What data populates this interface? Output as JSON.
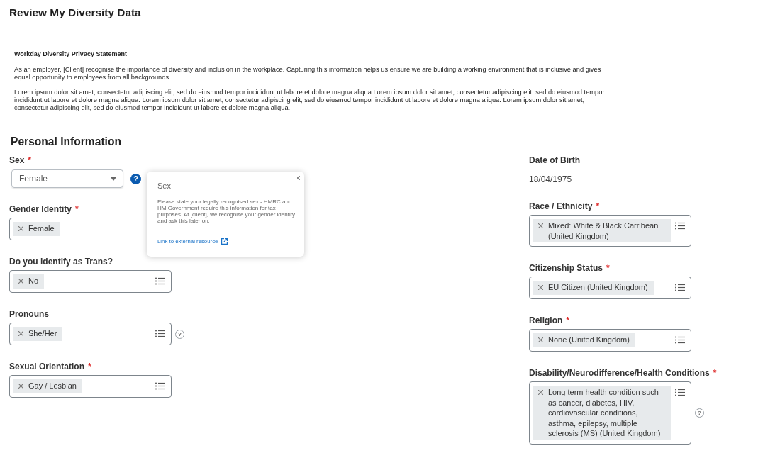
{
  "header": {
    "title": "Review My Diversity Data"
  },
  "privacy_statement": {
    "title": "Workday Diversity Privacy Statement",
    "paragraphs": [
      "As an employer, [Client] recognise the importance of diversity and inclusion in the workplace. Capturing this information helps us ensure we are building a working environment that is inclusive and gives equal opportunity to employees from all backgrounds.",
      "Lorem ipsum dolor sit amet, consectetur adipiscing elit, sed do eiusmod tempor incididunt ut labore et dolore magna aliqua.Lorem ipsum dolor sit amet, consectetur adipiscing elit, sed do eiusmod tempor incididunt ut labore et dolore magna aliqua. Lorem ipsum dolor sit amet, consectetur adipiscing elit, sed do eiusmod tempor incididunt ut labore et dolore magna aliqua. Lorem ipsum dolor sit amet, consectetur adipiscing elit, sed do eiusmod tempor incididunt ut labore et dolore magna aliqua."
    ]
  },
  "personal_information": {
    "title": "Personal Information",
    "left_fields": [
      {
        "kind": "dropdown",
        "label": "Sex",
        "required_mark": "*",
        "value": "Female",
        "help": {
          "text": "?",
          "active": true
        },
        "popover": {
          "title": "Sex",
          "text": "Please state your legally recognised sex - HMRC and HM Government require this information for tax purposes. At [client], we recognise your gender identity and ask this later on.",
          "link": "Link to external resource"
        }
      },
      {
        "kind": "multiselect",
        "label": "Gender Identity",
        "required_mark": "*",
        "tags": [
          "Female"
        ],
        "list_icon": false
      },
      {
        "kind": "multiselect",
        "label": "Do you identify as Trans?",
        "tags": [
          "No"
        ],
        "list_icon": true
      },
      {
        "kind": "multiselect",
        "label": "Pronouns",
        "tags": [
          "She/Her"
        ],
        "list_icon": true,
        "help": {
          "text": "?",
          "active": false
        }
      },
      {
        "kind": "multiselect",
        "label": "Sexual Orientation",
        "required_mark": "*",
        "tags": [
          "Gay / Lesbian"
        ],
        "list_icon": true
      }
    ],
    "right_fields": [
      {
        "kind": "text",
        "label": "Date of Birth",
        "value": "18/04/1975"
      },
      {
        "kind": "multiselect",
        "label": "Race / Ethnicity",
        "required_mark": "*",
        "tags": [
          "Mixed: White & Black Carribean (United Kingdom)"
        ],
        "list_icon": true
      },
      {
        "kind": "multiselect",
        "label": "Citizenship Status",
        "required_mark": "*",
        "tags": [
          "EU Citizen (United Kingdom)"
        ],
        "list_icon": true
      },
      {
        "kind": "multiselect",
        "label": "Religion",
        "required_mark": "*",
        "tags": [
          "None (United Kingdom)"
        ],
        "list_icon": true
      },
      {
        "kind": "multiselect",
        "label": "Disability/Neurodifference/Health Conditions",
        "required_mark": "*",
        "tags": [
          "Long term health condition such as cancer, diabetes, HIV, cardiovascular conditions, asthma, epilepsy, multiple sclerosis (MS) (United Kingdom)"
        ],
        "list_icon": true,
        "help": {
          "text": "?",
          "active": false
        }
      }
    ]
  }
}
